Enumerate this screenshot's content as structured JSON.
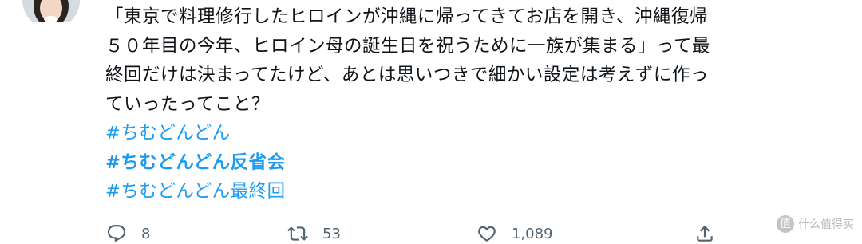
{
  "tweet": {
    "text": "「東京で料理修行したヒロインが沖縄に帰ってきてお店を開き、沖縄復帰\n５０年目の今年、ヒロイン母の誕生日を祝うために一族が集まる」って最\n終回だけは決まってたけど、あとは思いつきで細かい設定は考えずに作っ\nていったってこと？",
    "hashtags": [
      "#ちむどんどん",
      "#ちむどんどん反省会",
      "#ちむどんどん最終回"
    ]
  },
  "actions": {
    "reply_count": "8",
    "retweet_count": "53",
    "like_count": "1,089"
  },
  "watermark": {
    "logo": "值",
    "text": "什么值得买"
  },
  "colors": {
    "hashtag": "#1d9bf0",
    "icon": "#536471",
    "text": "#0f1419"
  }
}
